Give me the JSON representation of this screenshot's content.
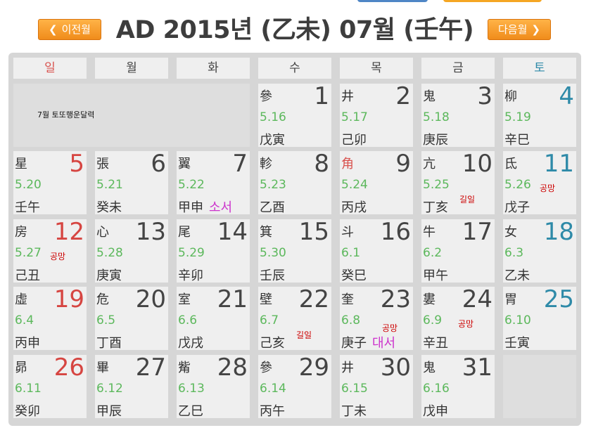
{
  "header": {
    "title": "AD 2015년 (乙未) 07월 (壬午)",
    "prev_label": "이전월",
    "next_label": "다음월"
  },
  "weekdays": [
    "일",
    "월",
    "화",
    "수",
    "목",
    "금",
    "토"
  ],
  "memo": "7월 토또행운달력",
  "days": [
    {
      "day": "1",
      "mansion": "參",
      "lunar": "5.16",
      "ganji": "戊寅"
    },
    {
      "day": "2",
      "mansion": "井",
      "lunar": "5.17",
      "ganji": "己卯"
    },
    {
      "day": "3",
      "mansion": "鬼",
      "lunar": "5.18",
      "ganji": "庚辰"
    },
    {
      "day": "4",
      "mansion": "柳",
      "lunar": "5.19",
      "ganji": "辛巳"
    },
    {
      "day": "5",
      "mansion": "星",
      "lunar": "5.20",
      "ganji": "壬午"
    },
    {
      "day": "6",
      "mansion": "張",
      "lunar": "5.21",
      "ganji": "癸未"
    },
    {
      "day": "7",
      "mansion": "翼",
      "lunar": "5.22",
      "ganji": "甲申",
      "term": "소서"
    },
    {
      "day": "8",
      "mansion": "軫",
      "lunar": "5.23",
      "ganji": "乙酉"
    },
    {
      "day": "9",
      "mansion": "角",
      "lunar": "5.24",
      "ganji": "丙戌"
    },
    {
      "day": "10",
      "mansion": "亢",
      "lunar": "5.25",
      "ganji": "丁亥",
      "tag": "길일"
    },
    {
      "day": "11",
      "mansion": "氐",
      "lunar": "5.26",
      "ganji": "戊子",
      "tag": "공망"
    },
    {
      "day": "12",
      "mansion": "房",
      "lunar": "5.27",
      "ganji": "己丑",
      "tag": "공망"
    },
    {
      "day": "13",
      "mansion": "心",
      "lunar": "5.28",
      "ganji": "庚寅"
    },
    {
      "day": "14",
      "mansion": "尾",
      "lunar": "5.29",
      "ganji": "辛卯"
    },
    {
      "day": "15",
      "mansion": "箕",
      "lunar": "5.30",
      "ganji": "壬辰"
    },
    {
      "day": "16",
      "mansion": "斗",
      "lunar": "6.1",
      "ganji": "癸巳"
    },
    {
      "day": "17",
      "mansion": "牛",
      "lunar": "6.2",
      "ganji": "甲午"
    },
    {
      "day": "18",
      "mansion": "女",
      "lunar": "6.3",
      "ganji": "乙未"
    },
    {
      "day": "19",
      "mansion": "虛",
      "lunar": "6.4",
      "ganji": "丙申"
    },
    {
      "day": "20",
      "mansion": "危",
      "lunar": "6.5",
      "ganji": "丁酉"
    },
    {
      "day": "21",
      "mansion": "室",
      "lunar": "6.6",
      "ganji": "戊戌"
    },
    {
      "day": "22",
      "mansion": "壁",
      "lunar": "6.7",
      "ganji": "己亥",
      "tag": "길일"
    },
    {
      "day": "23",
      "mansion": "奎",
      "lunar": "6.8",
      "ganji": "庚子",
      "tag": "공망",
      "term": "대서"
    },
    {
      "day": "24",
      "mansion": "婁",
      "lunar": "6.9",
      "ganji": "辛丑",
      "tag": "공망"
    },
    {
      "day": "25",
      "mansion": "胃",
      "lunar": "6.10",
      "ganji": "壬寅"
    },
    {
      "day": "26",
      "mansion": "昴",
      "lunar": "6.11",
      "ganji": "癸卯"
    },
    {
      "day": "27",
      "mansion": "畢",
      "lunar": "6.12",
      "ganji": "甲辰"
    },
    {
      "day": "28",
      "mansion": "觜",
      "lunar": "6.13",
      "ganji": "乙巳"
    },
    {
      "day": "29",
      "mansion": "參",
      "lunar": "6.14",
      "ganji": "丙午"
    },
    {
      "day": "30",
      "mansion": "井",
      "lunar": "6.15",
      "ganji": "丁未"
    },
    {
      "day": "31",
      "mansion": "鬼",
      "lunar": "6.16",
      "ganji": "戊申"
    }
  ]
}
